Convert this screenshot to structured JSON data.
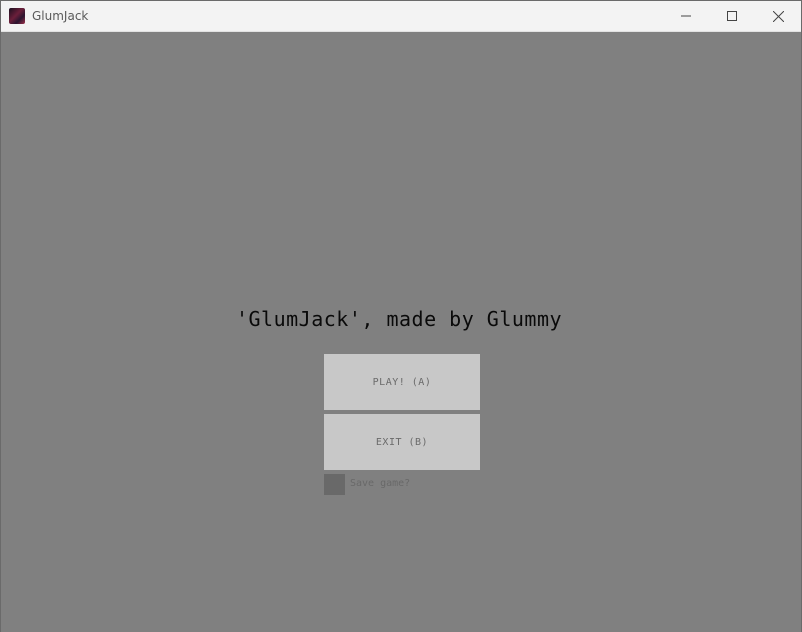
{
  "window": {
    "title": "GlumJack",
    "controls": {
      "minimize": "minimize-icon",
      "maximize": "maximize-icon",
      "close": "close-icon"
    }
  },
  "menu": {
    "heading": "'GlumJack', made by Glummy",
    "play_label": "PLAY! (A)",
    "exit_label": "EXIT (B)",
    "save_label": "Save game?",
    "save_checked": false
  },
  "colors": {
    "background": "#808080",
    "button": "#c8c8c8",
    "checkbox": "#696969",
    "titlebar": "#f3f3f3"
  }
}
